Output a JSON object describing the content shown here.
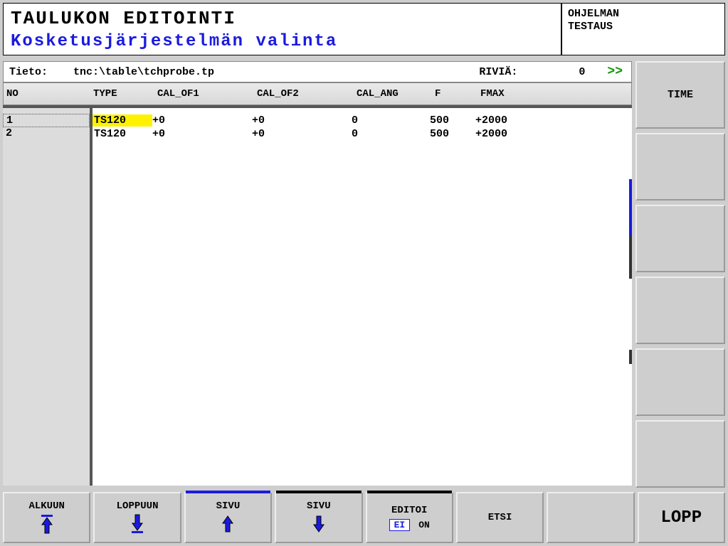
{
  "header": {
    "title_main": "TAULUKON EDITOINTI",
    "title_sub": "Kosketusjärjestelmän valinta",
    "mode_line1": "OHJELMAN",
    "mode_line2": "TESTAUS"
  },
  "info": {
    "tieto_label": "Tieto:",
    "path": "tnc:\\table\\tchprobe.tp",
    "rivia_label": "RIVIÄ:",
    "rivia_value": "0",
    "more_indicator": ">>"
  },
  "columns": {
    "no": "NO",
    "type": "TYPE",
    "cal_of1": "CAL_OF1",
    "cal_of2": "CAL_OF2",
    "cal_ang": "CAL_ANG",
    "f": "F",
    "fmax": "FMAX"
  },
  "rows": [
    {
      "no": "1",
      "type": "TS120",
      "cal_of1": "+0",
      "cal_of2": "+0",
      "cal_ang": "0",
      "f": "500",
      "fmax": "+2000",
      "highlighted": true
    },
    {
      "no": "2",
      "type": "TS120",
      "cal_of1": "+0",
      "cal_of2": "+0",
      "cal_ang": "0",
      "f": "500",
      "fmax": "+2000",
      "highlighted": false
    }
  ],
  "right_softkeys": [
    "TIME",
    "",
    "",
    "",
    "",
    ""
  ],
  "bottom_softkeys": {
    "begin": "ALKUUN",
    "end": "LOPPUUN",
    "page_up": "SIVU",
    "page_down": "SIVU",
    "edit_label": "EDITOI",
    "edit_off": "EI",
    "edit_on": "ON",
    "search": "ETSI",
    "quit": "LOPP"
  }
}
